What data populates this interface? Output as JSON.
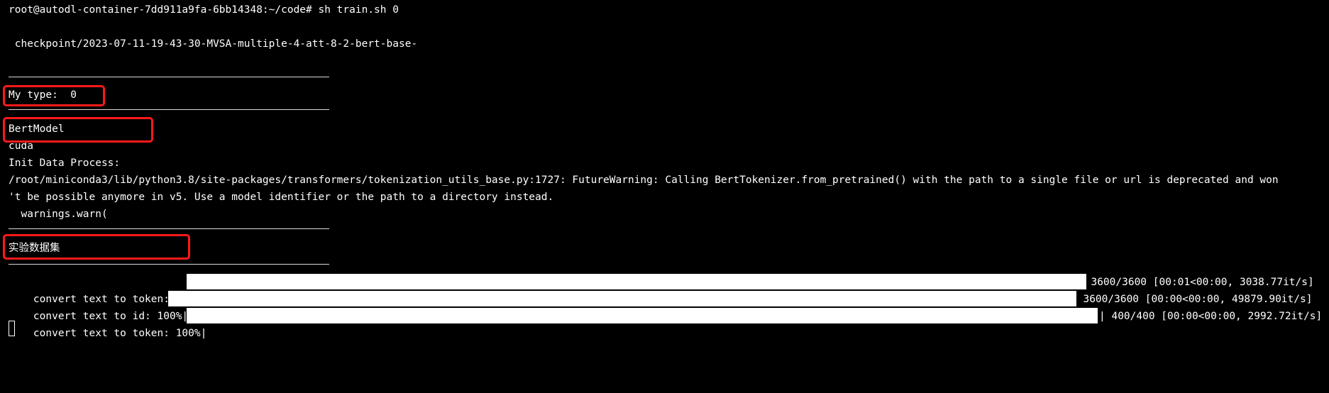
{
  "terminal": {
    "prompt_line": "root@autodl-container-7dd911a9fa-6bb14348:~/code# sh train.sh 0",
    "checkpoint_line": " checkpoint/2023-07-11-19-43-30-MVSA-multiple-4-att-8-2-bert-base-",
    "my_type_line": "My type:  0",
    "model_line": "BertModel",
    "device_line": "cuda",
    "init_line": "Init Data Process:",
    "warning_line_1": "/root/miniconda3/lib/python3.8/site-packages/transformers/tokenization_utils_base.py:1727: FutureWarning: Calling BertTokenizer.from_pretrained() with the path to a single file or url is deprecated and won",
    "warning_line_2": "'t be possible anymore in v5. Use a model identifier or the path to a directory instead.",
    "warning_line_3": "  warnings.warn(",
    "dataset_line": "实验数据集",
    "progress": [
      {
        "label": "convert text to token: 100%|",
        "percent": 100,
        "stats": "| 3600/3600 [00:01<00:00, 3038.77it/s]"
      },
      {
        "label": "convert text to id: 100%|",
        "percent": 100,
        "stats": "| 3600/3600 [00:00<00:00, 49879.90it/s]"
      },
      {
        "label": "convert text to token: 100%|",
        "percent": 100,
        "stats": "| 400/400 [00:00<00:00, 2992.72it/s]"
      }
    ]
  }
}
